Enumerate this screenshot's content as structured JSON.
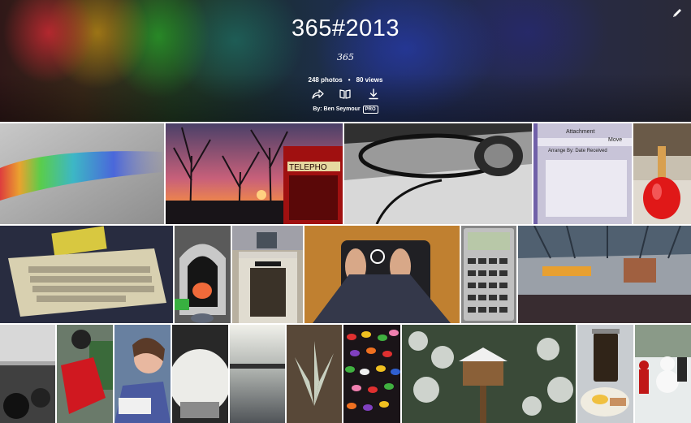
{
  "album": {
    "title": "365#2013",
    "description": "365",
    "photo_count": "248 photos",
    "separator": "•",
    "view_count": "80 views",
    "owner_line": "By: Ben Seymour",
    "pro_badge": "PRO"
  },
  "actions": [
    "share-icon",
    "book-icon",
    "download-icon"
  ],
  "colors": {
    "cover_dark": "#2a2a38",
    "text": "#ffffff",
    "tile_gap": "#ffffff"
  },
  "tiles": [
    {
      "row": 1,
      "subject": "rainbow-light-on-wall"
    },
    {
      "row": 1,
      "subject": "sunset-with-red-phone-box",
      "text": "TELEPHO"
    },
    {
      "row": 1,
      "subject": "headphones-on-laptop"
    },
    {
      "row": 1,
      "subject": "mail-app-screen",
      "text": [
        "Attachment",
        "Move",
        "Arrange By: Date Received"
      ]
    },
    {
      "row": 1,
      "subject": "red-flask"
    },
    {
      "row": 2,
      "subject": "retro-keyboard-computer"
    },
    {
      "row": 2,
      "subject": "fireplace-with-feet"
    },
    {
      "row": 2,
      "subject": "shop-front"
    },
    {
      "row": 2,
      "subject": "feet-on-scale"
    },
    {
      "row": 2,
      "subject": "calculator"
    },
    {
      "row": 2,
      "subject": "train-station-hall"
    },
    {
      "row": 3,
      "subject": "motorbikes-street"
    },
    {
      "row": 3,
      "subject": "red-motorbike"
    },
    {
      "row": 3,
      "subject": "child-drawing"
    },
    {
      "row": 3,
      "subject": "snowy-car"
    },
    {
      "row": 3,
      "subject": "car-park-dusk"
    },
    {
      "row": 3,
      "subject": "frosty-plant"
    },
    {
      "row": 3,
      "subject": "jelly-beans"
    },
    {
      "row": 3,
      "subject": "snowy-bird-feeder"
    },
    {
      "row": 3,
      "subject": "cafetiere-breakfast"
    },
    {
      "row": 3,
      "subject": "snowman-with-kids"
    }
  ]
}
